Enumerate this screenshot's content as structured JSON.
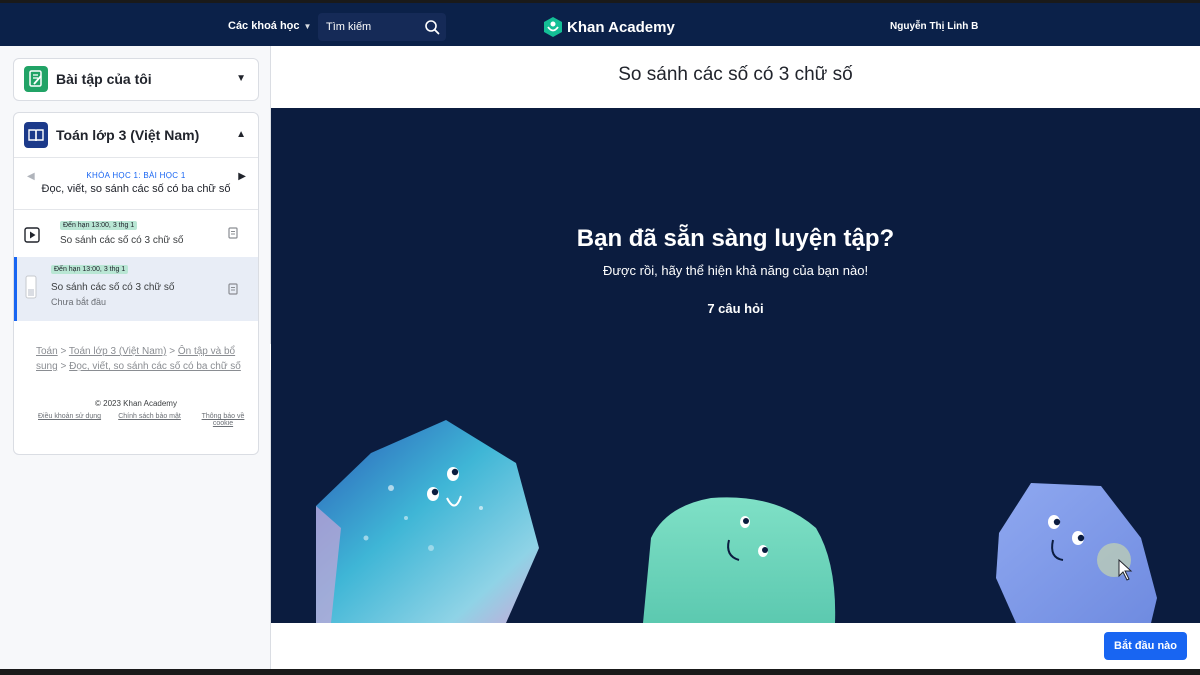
{
  "nav": {
    "courses_label": "Các khoá học",
    "search_placeholder": "Tìm kiếm",
    "logo_text": "Khan Academy",
    "user_name": "Nguyễn Thị Linh B"
  },
  "sidebar": {
    "my_exercises": {
      "title": "Bài tập của tôi",
      "icon": "exercise-pencil-icon"
    },
    "course": {
      "title": "Toán lớp 3 (Việt Nam)",
      "icon": "book-icon",
      "unit_kicker": "KHÓA HỌC 1: BÀI HỌC 1",
      "unit_title": "Đọc, viết, so sánh các số có ba chữ số",
      "items": [
        {
          "badge": "Đến hạn 13:00, 3 thg 1",
          "name": "So sánh các số có 3 chữ số",
          "status": "",
          "icon": "video-play-icon"
        },
        {
          "badge": "Đến hạn 13:00, 3 thg 1",
          "name": "So sánh các số có 3 chữ số",
          "status": "Chưa bắt đầu",
          "icon": "exercise-bar-icon"
        }
      ],
      "breadcrumbs": [
        "Toán",
        "Toán lớp 3 (Việt Nam)",
        "Ôn tập và bổ sung",
        "Đọc, viết, so sánh các số có ba chữ số"
      ],
      "copyright": "© 2023 Khan Academy",
      "footer_links": [
        "Điều khoản sử dụng",
        "Chính sách bảo mật",
        "Thông báo về cookie"
      ]
    }
  },
  "main": {
    "title": "So sánh các số có 3 chữ số",
    "heading": "Bạn đã sẵn sàng luyện tập?",
    "subheading": "Được rồi, hãy thể hiện khả năng của bạn nào!",
    "question_count": "7 câu hỏi",
    "start_button": "Bắt đầu nào"
  },
  "colors": {
    "nav_bg": "#0b2149",
    "stage_bg": "#0b1c3f",
    "accent_blue": "#1865f2",
    "badge_green": "#b9e6d4"
  }
}
